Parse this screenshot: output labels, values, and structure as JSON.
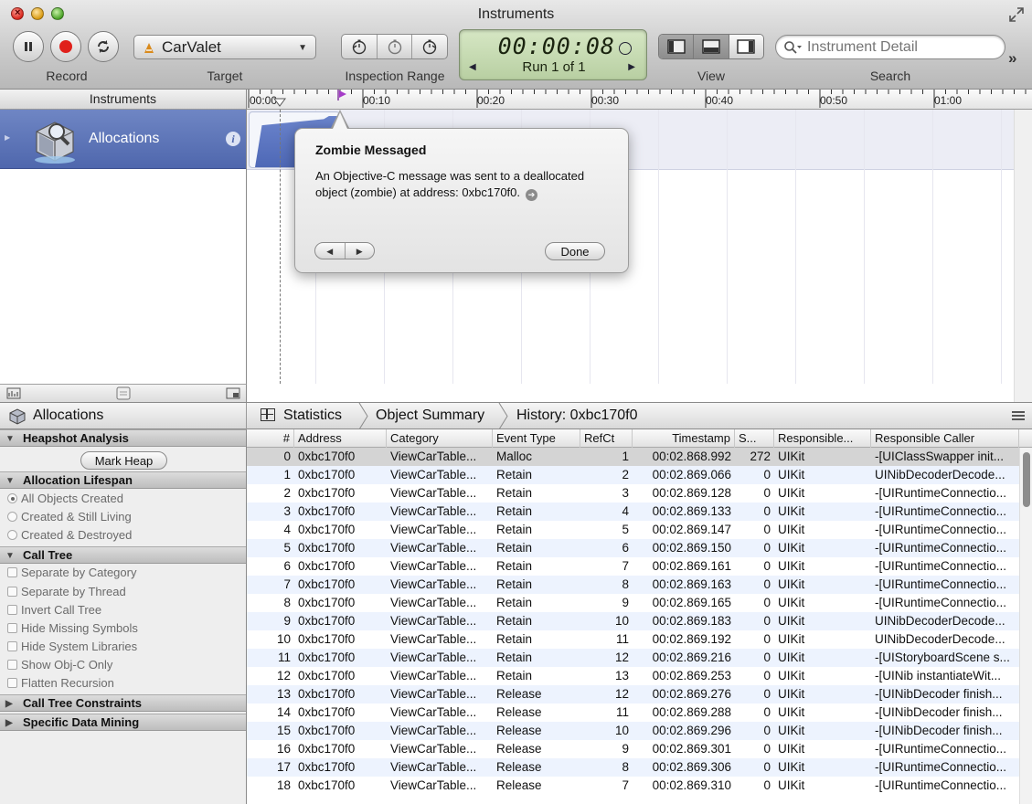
{
  "window": {
    "title": "Instruments"
  },
  "toolbar": {
    "record_label": "Record",
    "target": {
      "value": "CarValet",
      "label": "Target"
    },
    "inspection_label": "Inspection Range",
    "lcd": {
      "time": "00:00:08",
      "run": "Run 1 of 1"
    },
    "view_label": "View",
    "search": {
      "placeholder": "Instrument Detail",
      "label": "Search"
    }
  },
  "instruments_pane": {
    "header": "Instruments",
    "items": [
      {
        "label": "Allocations"
      }
    ]
  },
  "timeline": {
    "ticks": [
      "00:00",
      "00:10",
      "00:20",
      "00:30",
      "00:40",
      "00:50",
      "01:00"
    ]
  },
  "popover": {
    "title": "Zombie Messaged",
    "body": "An Objective-C message was sent to a deallocated object (zombie) at address: 0xbc170f0.",
    "done_label": "Done"
  },
  "detail_bar": {
    "left_title": "Allocations",
    "breadcrumbs": [
      "Statistics",
      "Object Summary",
      "History: 0xbc170f0"
    ]
  },
  "options": {
    "heapshot": {
      "title": "Heapshot Analysis",
      "button": "Mark Heap"
    },
    "lifespan": {
      "title": "Allocation Lifespan",
      "options": [
        "All Objects Created",
        "Created & Still Living",
        "Created & Destroyed"
      ],
      "selected": "All Objects Created"
    },
    "call_tree": {
      "title": "Call Tree",
      "options": [
        "Separate by Category",
        "Separate by Thread",
        "Invert Call Tree",
        "Hide Missing Symbols",
        "Hide System Libraries",
        "Show Obj-C Only",
        "Flatten Recursion"
      ]
    },
    "constraints": {
      "title": "Call Tree Constraints"
    },
    "data_mining": {
      "title": "Specific Data Mining"
    }
  },
  "table": {
    "columns": [
      "#",
      "Address",
      "Category",
      "Event Type",
      "RefCt",
      "Timestamp",
      "S...",
      "Responsible...",
      "Responsible Caller"
    ],
    "rows": [
      [
        "0",
        "0xbc170f0",
        "ViewCarTable...",
        "Malloc",
        "1",
        "00:02.868.992",
        "272",
        "UIKit",
        "-[UIClassSwapper init..."
      ],
      [
        "1",
        "0xbc170f0",
        "ViewCarTable...",
        "Retain",
        "2",
        "00:02.869.066",
        "0",
        "UIKit",
        "UINibDecoderDecode..."
      ],
      [
        "2",
        "0xbc170f0",
        "ViewCarTable...",
        "Retain",
        "3",
        "00:02.869.128",
        "0",
        "UIKit",
        "-[UIRuntimeConnectio..."
      ],
      [
        "3",
        "0xbc170f0",
        "ViewCarTable...",
        "Retain",
        "4",
        "00:02.869.133",
        "0",
        "UIKit",
        "-[UIRuntimeConnectio..."
      ],
      [
        "4",
        "0xbc170f0",
        "ViewCarTable...",
        "Retain",
        "5",
        "00:02.869.147",
        "0",
        "UIKit",
        "-[UIRuntimeConnectio..."
      ],
      [
        "5",
        "0xbc170f0",
        "ViewCarTable...",
        "Retain",
        "6",
        "00:02.869.150",
        "0",
        "UIKit",
        "-[UIRuntimeConnectio..."
      ],
      [
        "6",
        "0xbc170f0",
        "ViewCarTable...",
        "Retain",
        "7",
        "00:02.869.161",
        "0",
        "UIKit",
        "-[UIRuntimeConnectio..."
      ],
      [
        "7",
        "0xbc170f0",
        "ViewCarTable...",
        "Retain",
        "8",
        "00:02.869.163",
        "0",
        "UIKit",
        "-[UIRuntimeConnectio..."
      ],
      [
        "8",
        "0xbc170f0",
        "ViewCarTable...",
        "Retain",
        "9",
        "00:02.869.165",
        "0",
        "UIKit",
        "-[UIRuntimeConnectio..."
      ],
      [
        "9",
        "0xbc170f0",
        "ViewCarTable...",
        "Retain",
        "10",
        "00:02.869.183",
        "0",
        "UIKit",
        "UINibDecoderDecode..."
      ],
      [
        "10",
        "0xbc170f0",
        "ViewCarTable...",
        "Retain",
        "11",
        "00:02.869.192",
        "0",
        "UIKit",
        "UINibDecoderDecode..."
      ],
      [
        "11",
        "0xbc170f0",
        "ViewCarTable...",
        "Retain",
        "12",
        "00:02.869.216",
        "0",
        "UIKit",
        "-[UIStoryboardScene s..."
      ],
      [
        "12",
        "0xbc170f0",
        "ViewCarTable...",
        "Retain",
        "13",
        "00:02.869.253",
        "0",
        "UIKit",
        "-[UINib instantiateWit..."
      ],
      [
        "13",
        "0xbc170f0",
        "ViewCarTable...",
        "Release",
        "12",
        "00:02.869.276",
        "0",
        "UIKit",
        "-[UINibDecoder finish..."
      ],
      [
        "14",
        "0xbc170f0",
        "ViewCarTable...",
        "Release",
        "11",
        "00:02.869.288",
        "0",
        "UIKit",
        "-[UINibDecoder finish..."
      ],
      [
        "15",
        "0xbc170f0",
        "ViewCarTable...",
        "Release",
        "10",
        "00:02.869.296",
        "0",
        "UIKit",
        "-[UINibDecoder finish..."
      ],
      [
        "16",
        "0xbc170f0",
        "ViewCarTable...",
        "Release",
        "9",
        "00:02.869.301",
        "0",
        "UIKit",
        "-[UIRuntimeConnectio..."
      ],
      [
        "17",
        "0xbc170f0",
        "ViewCarTable...",
        "Release",
        "8",
        "00:02.869.306",
        "0",
        "UIKit",
        "-[UIRuntimeConnectio..."
      ],
      [
        "18",
        "0xbc170f0",
        "ViewCarTable...",
        "Release",
        "7",
        "00:02.869.310",
        "0",
        "UIKit",
        "-[UIRuntimeConnectio..."
      ]
    ],
    "selected_row": 0
  },
  "colors": {
    "accent": "#4f67ad",
    "record_red": "#e0201b",
    "lcd_bg": "#c7dbb2",
    "row_stripe": "#edf3fe"
  },
  "icons": [
    "pause-icon",
    "record-icon",
    "restart-icon",
    "search-icon",
    "info-icon",
    "stopwatch-icon",
    "zombie-goto-icon"
  ]
}
